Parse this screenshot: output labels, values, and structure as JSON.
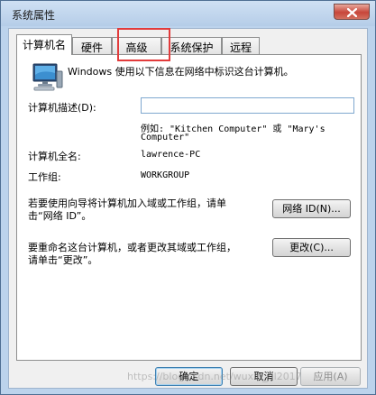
{
  "window": {
    "title": "系统属性"
  },
  "tabs": [
    {
      "label": "计算机名",
      "active": true
    },
    {
      "label": "硬件",
      "active": false
    },
    {
      "label": "高级",
      "active": false
    },
    {
      "label": "系统保护",
      "active": false
    },
    {
      "label": "远程",
      "active": false
    }
  ],
  "computer_name_tab": {
    "intro": "Windows 使用以下信息在网络中标识这台计算机。",
    "description_label": "计算机描述(D):",
    "description_value": "",
    "example_line1": "例如: \"Kitchen Computer\" 或 \"Mary's",
    "example_line2": "Computer\"",
    "full_name_label": "计算机全名:",
    "full_name_value": "lawrence-PC",
    "workgroup_label": "工作组:",
    "workgroup_value": "WORKGROUP",
    "network_text_line1": "若要使用向导将计算机加入域或工作组，请单",
    "network_text_line2": "击“网络 ID”。",
    "network_id_button": "网络 ID(N)...",
    "rename_text_line1": "要重命名这台计算机，或者更改其域或工作组，",
    "rename_text_line2": "请单击“更改”。",
    "change_button": "更改(C)..."
  },
  "footer": {
    "ok": "确定",
    "cancel": "取消",
    "apply": "应用(A)"
  },
  "watermark": "https://blog.csdn.net/wuxin_dl2017",
  "colors": {
    "highlight": "#e23b3b",
    "input_border": "#7fa8cf"
  }
}
